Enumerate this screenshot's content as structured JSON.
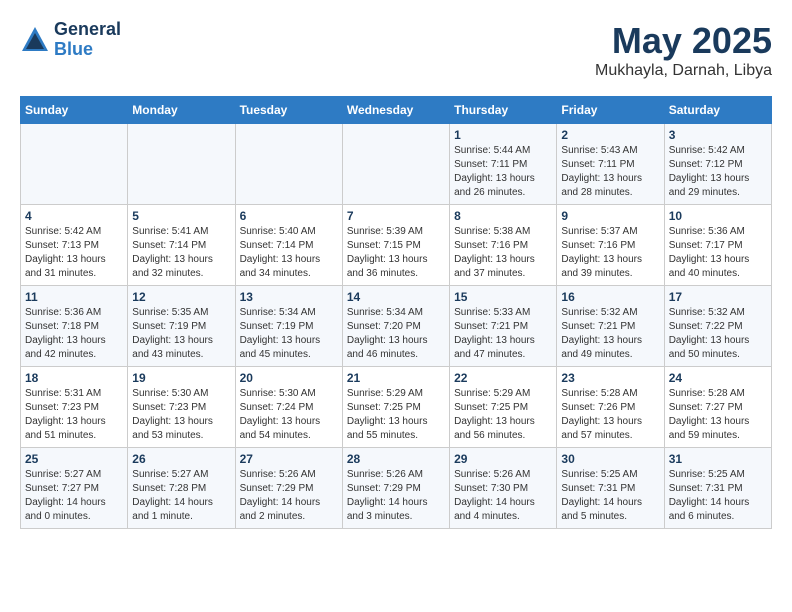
{
  "app": {
    "logo_general": "General",
    "logo_blue": "Blue"
  },
  "title": "May 2025",
  "subtitle": "Mukhayla, Darnah, Libya",
  "days_of_week": [
    "Sunday",
    "Monday",
    "Tuesday",
    "Wednesday",
    "Thursday",
    "Friday",
    "Saturday"
  ],
  "weeks": [
    [
      {
        "day": "",
        "info": ""
      },
      {
        "day": "",
        "info": ""
      },
      {
        "day": "",
        "info": ""
      },
      {
        "day": "",
        "info": ""
      },
      {
        "day": "1",
        "info": "Sunrise: 5:44 AM\nSunset: 7:11 PM\nDaylight: 13 hours\nand 26 minutes."
      },
      {
        "day": "2",
        "info": "Sunrise: 5:43 AM\nSunset: 7:11 PM\nDaylight: 13 hours\nand 28 minutes."
      },
      {
        "day": "3",
        "info": "Sunrise: 5:42 AM\nSunset: 7:12 PM\nDaylight: 13 hours\nand 29 minutes."
      }
    ],
    [
      {
        "day": "4",
        "info": "Sunrise: 5:42 AM\nSunset: 7:13 PM\nDaylight: 13 hours\nand 31 minutes."
      },
      {
        "day": "5",
        "info": "Sunrise: 5:41 AM\nSunset: 7:14 PM\nDaylight: 13 hours\nand 32 minutes."
      },
      {
        "day": "6",
        "info": "Sunrise: 5:40 AM\nSunset: 7:14 PM\nDaylight: 13 hours\nand 34 minutes."
      },
      {
        "day": "7",
        "info": "Sunrise: 5:39 AM\nSunset: 7:15 PM\nDaylight: 13 hours\nand 36 minutes."
      },
      {
        "day": "8",
        "info": "Sunrise: 5:38 AM\nSunset: 7:16 PM\nDaylight: 13 hours\nand 37 minutes."
      },
      {
        "day": "9",
        "info": "Sunrise: 5:37 AM\nSunset: 7:16 PM\nDaylight: 13 hours\nand 39 minutes."
      },
      {
        "day": "10",
        "info": "Sunrise: 5:36 AM\nSunset: 7:17 PM\nDaylight: 13 hours\nand 40 minutes."
      }
    ],
    [
      {
        "day": "11",
        "info": "Sunrise: 5:36 AM\nSunset: 7:18 PM\nDaylight: 13 hours\nand 42 minutes."
      },
      {
        "day": "12",
        "info": "Sunrise: 5:35 AM\nSunset: 7:19 PM\nDaylight: 13 hours\nand 43 minutes."
      },
      {
        "day": "13",
        "info": "Sunrise: 5:34 AM\nSunset: 7:19 PM\nDaylight: 13 hours\nand 45 minutes."
      },
      {
        "day": "14",
        "info": "Sunrise: 5:34 AM\nSunset: 7:20 PM\nDaylight: 13 hours\nand 46 minutes."
      },
      {
        "day": "15",
        "info": "Sunrise: 5:33 AM\nSunset: 7:21 PM\nDaylight: 13 hours\nand 47 minutes."
      },
      {
        "day": "16",
        "info": "Sunrise: 5:32 AM\nSunset: 7:21 PM\nDaylight: 13 hours\nand 49 minutes."
      },
      {
        "day": "17",
        "info": "Sunrise: 5:32 AM\nSunset: 7:22 PM\nDaylight: 13 hours\nand 50 minutes."
      }
    ],
    [
      {
        "day": "18",
        "info": "Sunrise: 5:31 AM\nSunset: 7:23 PM\nDaylight: 13 hours\nand 51 minutes."
      },
      {
        "day": "19",
        "info": "Sunrise: 5:30 AM\nSunset: 7:23 PM\nDaylight: 13 hours\nand 53 minutes."
      },
      {
        "day": "20",
        "info": "Sunrise: 5:30 AM\nSunset: 7:24 PM\nDaylight: 13 hours\nand 54 minutes."
      },
      {
        "day": "21",
        "info": "Sunrise: 5:29 AM\nSunset: 7:25 PM\nDaylight: 13 hours\nand 55 minutes."
      },
      {
        "day": "22",
        "info": "Sunrise: 5:29 AM\nSunset: 7:25 PM\nDaylight: 13 hours\nand 56 minutes."
      },
      {
        "day": "23",
        "info": "Sunrise: 5:28 AM\nSunset: 7:26 PM\nDaylight: 13 hours\nand 57 minutes."
      },
      {
        "day": "24",
        "info": "Sunrise: 5:28 AM\nSunset: 7:27 PM\nDaylight: 13 hours\nand 59 minutes."
      }
    ],
    [
      {
        "day": "25",
        "info": "Sunrise: 5:27 AM\nSunset: 7:27 PM\nDaylight: 14 hours\nand 0 minutes."
      },
      {
        "day": "26",
        "info": "Sunrise: 5:27 AM\nSunset: 7:28 PM\nDaylight: 14 hours\nand 1 minute."
      },
      {
        "day": "27",
        "info": "Sunrise: 5:26 AM\nSunset: 7:29 PM\nDaylight: 14 hours\nand 2 minutes."
      },
      {
        "day": "28",
        "info": "Sunrise: 5:26 AM\nSunset: 7:29 PM\nDaylight: 14 hours\nand 3 minutes."
      },
      {
        "day": "29",
        "info": "Sunrise: 5:26 AM\nSunset: 7:30 PM\nDaylight: 14 hours\nand 4 minutes."
      },
      {
        "day": "30",
        "info": "Sunrise: 5:25 AM\nSunset: 7:31 PM\nDaylight: 14 hours\nand 5 minutes."
      },
      {
        "day": "31",
        "info": "Sunrise: 5:25 AM\nSunset: 7:31 PM\nDaylight: 14 hours\nand 6 minutes."
      }
    ]
  ]
}
